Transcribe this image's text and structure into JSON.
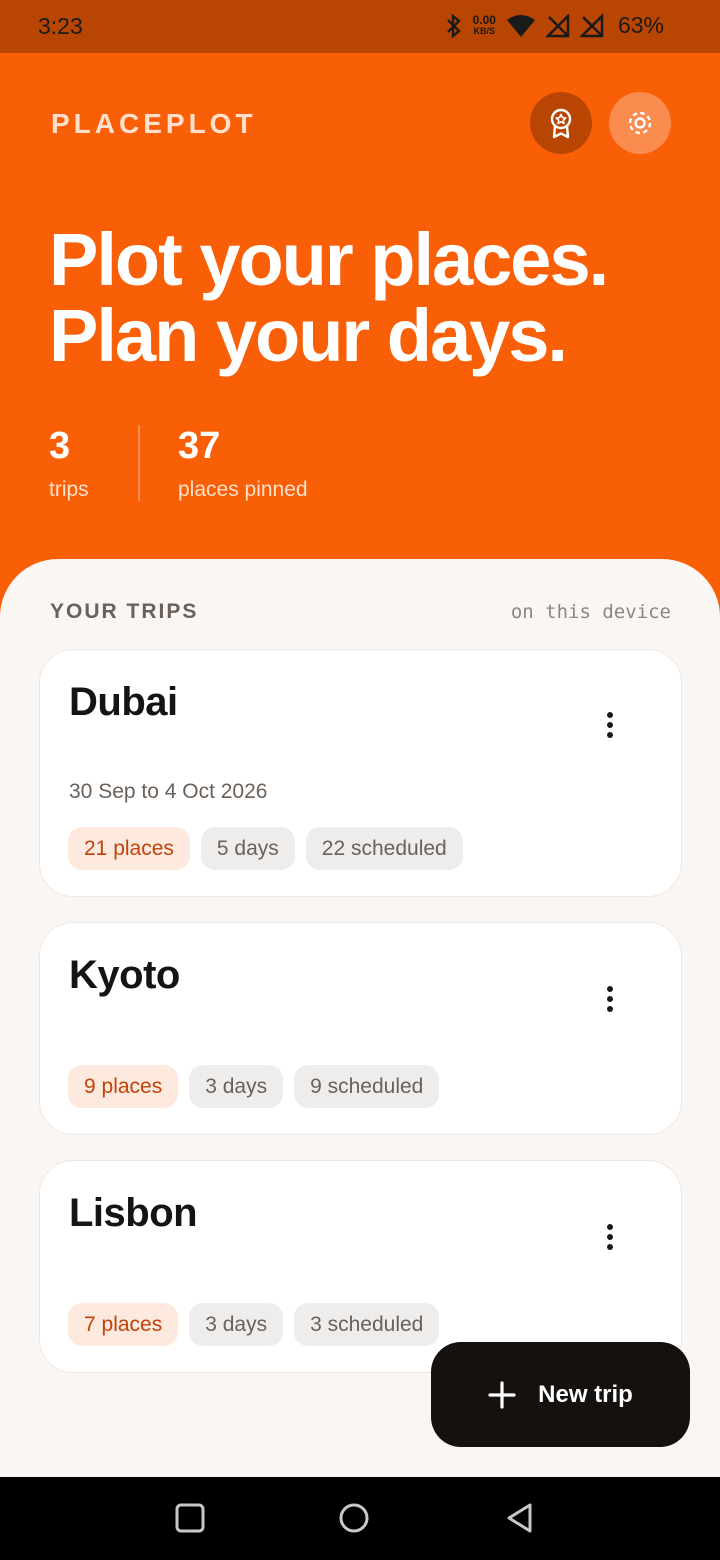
{
  "status_bar": {
    "time": "3:23",
    "net_speed_value": "0.00",
    "net_speed_unit": "KB/S",
    "battery": "63%"
  },
  "header": {
    "brand": "PLACEPLOT",
    "headline_line1": "Plot your places.",
    "headline_line2": "Plan your days."
  },
  "icons": {
    "award": "award-icon",
    "settings": "gear-icon",
    "more": "more-vertical-icon",
    "add": "plus-icon"
  },
  "stats": [
    {
      "value": "3",
      "label": "trips"
    },
    {
      "value": "37",
      "label": "places pinned"
    }
  ],
  "section": {
    "title": "YOUR TRIPS",
    "note": "on this device"
  },
  "trips": [
    {
      "name": "Dubai",
      "dates": "30 Sep to 4 Oct 2026",
      "places": "21 places",
      "days": "5 days",
      "scheduled": "22 scheduled"
    },
    {
      "name": "Kyoto",
      "dates": "",
      "places": "9 places",
      "days": "3 days",
      "scheduled": "9 scheduled"
    },
    {
      "name": "Lisbon",
      "dates": "",
      "places": "7 places",
      "days": "3 days",
      "scheduled": "3 scheduled"
    }
  ],
  "fab": {
    "label": "New trip"
  },
  "colors": {
    "brand_orange": "#f95f07",
    "dark_orange": "#b94502",
    "sheet_bg": "#faf6f3",
    "fab_bg": "#15110f",
    "chip_accent_text": "#c2420a"
  }
}
